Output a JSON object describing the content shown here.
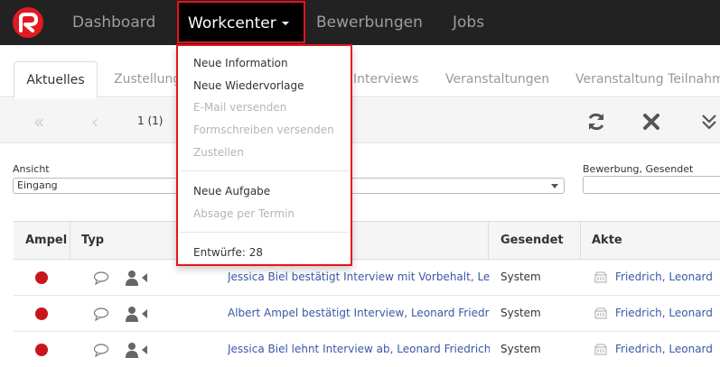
{
  "nav": {
    "items": [
      {
        "label": "Dashboard"
      },
      {
        "label": "Workcenter"
      },
      {
        "label": "Bewerbungen"
      },
      {
        "label": "Jobs"
      }
    ]
  },
  "tabs": [
    {
      "label": "Aktuelles",
      "active": true
    },
    {
      "label": "Zustellung"
    },
    {
      "label": "Interviews"
    },
    {
      "label": "Veranstaltungen"
    },
    {
      "label": "Veranstaltung Teilnahm"
    }
  ],
  "toolbar": {
    "first_icon": "«",
    "prev_icon": "‹",
    "page_info": "1 (1)",
    "refresh_icon": "refresh-icon",
    "close_icon": "close-icon",
    "expand_icon": "chevrons-down-icon"
  },
  "filters": {
    "ansicht_label": "Ansicht",
    "ansicht_value": "Eingang",
    "bewerbung_label": "Bewerbung, Gesendet"
  },
  "table": {
    "headers": {
      "ampel": "Ampel",
      "typ": "Typ",
      "gesendet": "Gesendet",
      "akte": "Akte"
    },
    "rows": [
      {
        "subject": "Jessica Biel bestätigt Interview mit Vorbehalt, Leonard Friedrich",
        "sender": "System",
        "akte": "Friedrich, Leonard"
      },
      {
        "subject": "Albert Ampel bestätigt Interview, Leonard Friedrich",
        "sender": "System",
        "akte": "Friedrich, Leonard"
      },
      {
        "subject": "Jessica Biel lehnt Interview ab, Leonard Friedrich",
        "sender": "System",
        "akte": "Friedrich, Leonard"
      }
    ],
    "status_color": "#c9161d"
  },
  "menu": {
    "items": [
      {
        "label": "Neue Information",
        "enabled": true
      },
      {
        "label": "Neue Wiedervorlage",
        "enabled": true
      },
      {
        "label": "E-Mail versenden",
        "enabled": false
      },
      {
        "label": "Formschreiben versenden",
        "enabled": false
      },
      {
        "label": "Zustellen",
        "enabled": false
      },
      {
        "label": "Neue Aufgabe",
        "enabled": true
      },
      {
        "label": "Absage per Termin",
        "enabled": false
      },
      {
        "label": "Entwürfe: 28",
        "enabled": true
      }
    ]
  },
  "colors": {
    "navbar": "#222222",
    "highlight": "#e8141b",
    "link": "#3a57a7",
    "brand": "#e21a22"
  }
}
